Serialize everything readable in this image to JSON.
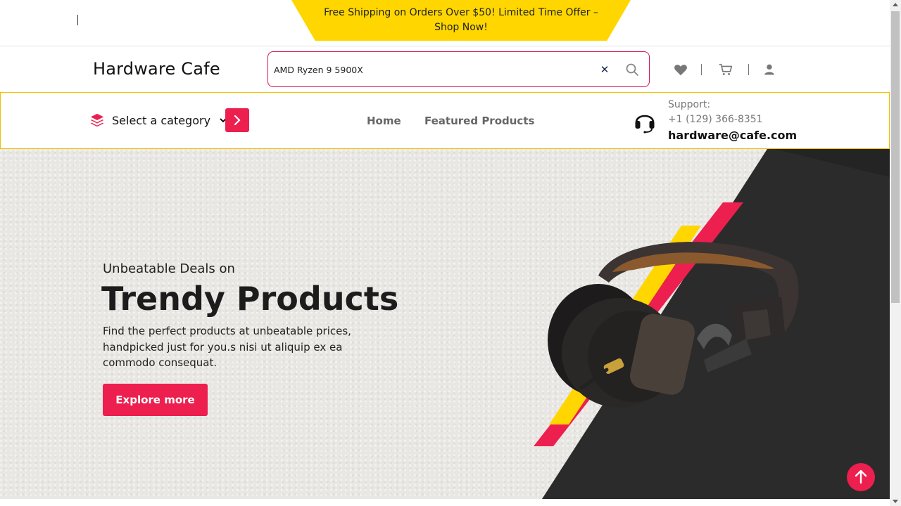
{
  "promo": {
    "text": "Free Shipping on Orders Over $50! Limited Time Offer – Shop Now!"
  },
  "header": {
    "logo": "Hardware Cafe",
    "search": {
      "value": "AMD Ryzen 9 5900X",
      "clear_icon": "close-icon",
      "search_icon": "search-icon"
    },
    "icons": [
      "heart-icon",
      "cart-icon",
      "user-icon"
    ]
  },
  "navbar": {
    "category": {
      "label": "Select a category",
      "icon": "layers-icon"
    },
    "links": [
      "Home",
      "Featured Products"
    ],
    "support": {
      "label": "Support:",
      "phone": "+1 (129) 366-8351",
      "email": "hardware@cafe.com",
      "icon": "headset-icon"
    }
  },
  "hero": {
    "kicker": "Unbeatable Deals on",
    "headline": "Trendy Products",
    "description": "Find the perfect products at unbeatable prices, handpicked just for you.s nisi ut aliquip ex ea commodo consequat.",
    "cta": "Explore more",
    "image": "headphones-image"
  },
  "colors": {
    "accent": "#ec1f4e",
    "yellow": "#ffd600",
    "dark_panel": "#2a2a2a"
  }
}
